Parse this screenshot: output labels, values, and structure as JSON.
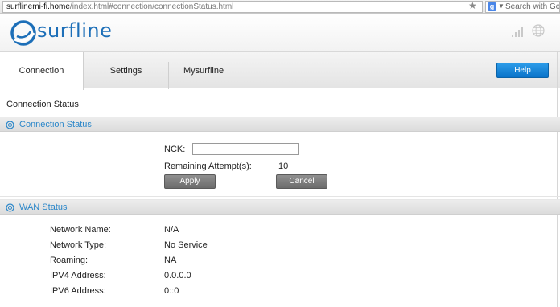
{
  "browser": {
    "url_host": "surflinemi-fi.home",
    "url_path": "/index.html#connection/connectionStatus.html",
    "search_placeholder": "Search with Goo",
    "search_engine_badge": "g",
    "bookmark_icon": "star-icon"
  },
  "header": {
    "logo_text": "surfline",
    "brand_color": "#1d6fb8",
    "signal_icon": "signal-bars-icon",
    "globe_icon": "globe-icon"
  },
  "tabs": [
    {
      "label": "Connection",
      "active": true
    },
    {
      "label": "Settings",
      "active": false
    },
    {
      "label": "Mysurfline",
      "active": false
    }
  ],
  "help_label": "Help",
  "page_title": "Connection Status",
  "connection_section": {
    "title": "Connection Status",
    "nck_label": "NCK:",
    "nck_value": "",
    "remaining_label": "Remaining Attempt(s):",
    "remaining_value": "10",
    "apply_label": "Apply",
    "cancel_label": "Cancel"
  },
  "wan_section": {
    "title": "WAN Status",
    "rows": [
      {
        "label": "Network Name:",
        "value": "N/A"
      },
      {
        "label": "Network Type:",
        "value": "No Service"
      },
      {
        "label": "Roaming:",
        "value": "NA"
      },
      {
        "label": "IPV4 Address:",
        "value": "0.0.0.0"
      },
      {
        "label": "IPV6 Address:",
        "value": "0::0"
      }
    ]
  },
  "colors": {
    "accent": "#2a86c9",
    "help_button": "#0a73c9",
    "grey_button": "#7a7a7a"
  }
}
